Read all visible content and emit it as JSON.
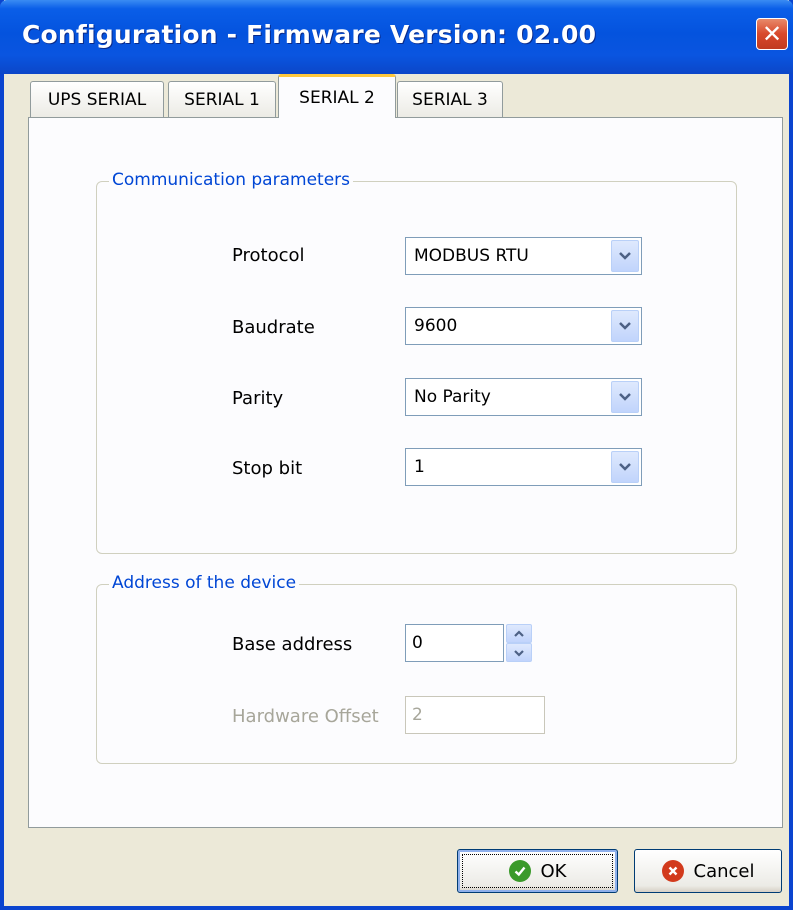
{
  "window": {
    "title": "Configuration - Firmware Version: 02.00",
    "close_label": "✕"
  },
  "tabs": [
    {
      "label": "UPS SERIAL"
    },
    {
      "label": "SERIAL 1"
    },
    {
      "label": "SERIAL 2",
      "active": true
    },
    {
      "label": "SERIAL 3"
    }
  ],
  "communication": {
    "legend": "Communication parameters",
    "protocol_label": "Protocol",
    "protocol_value": "MODBUS RTU",
    "baudrate_label": "Baudrate",
    "baudrate_value": "9600",
    "parity_label": "Parity",
    "parity_value": "No Parity",
    "stopbit_label": "Stop bit",
    "stopbit_value": "1"
  },
  "address": {
    "legend": "Address of the device",
    "base_label": "Base address",
    "base_value": "0",
    "offset_label": "Hardware Offset",
    "offset_value": "2"
  },
  "buttons": {
    "ok_label": "OK",
    "cancel_label": "Cancel"
  },
  "icons": {
    "close": "close-icon",
    "dropdown": "chevron-down-icon",
    "spin_up": "spin-up-icon",
    "spin_down": "spin-down-icon",
    "ok": "check-circle-icon",
    "cancel": "x-circle-icon"
  },
  "colors": {
    "titlebar": "#0453de",
    "dialog_bg": "#ece9d8",
    "legend_text": "#0046d5",
    "active_tab_accent": "#ffc83c"
  }
}
